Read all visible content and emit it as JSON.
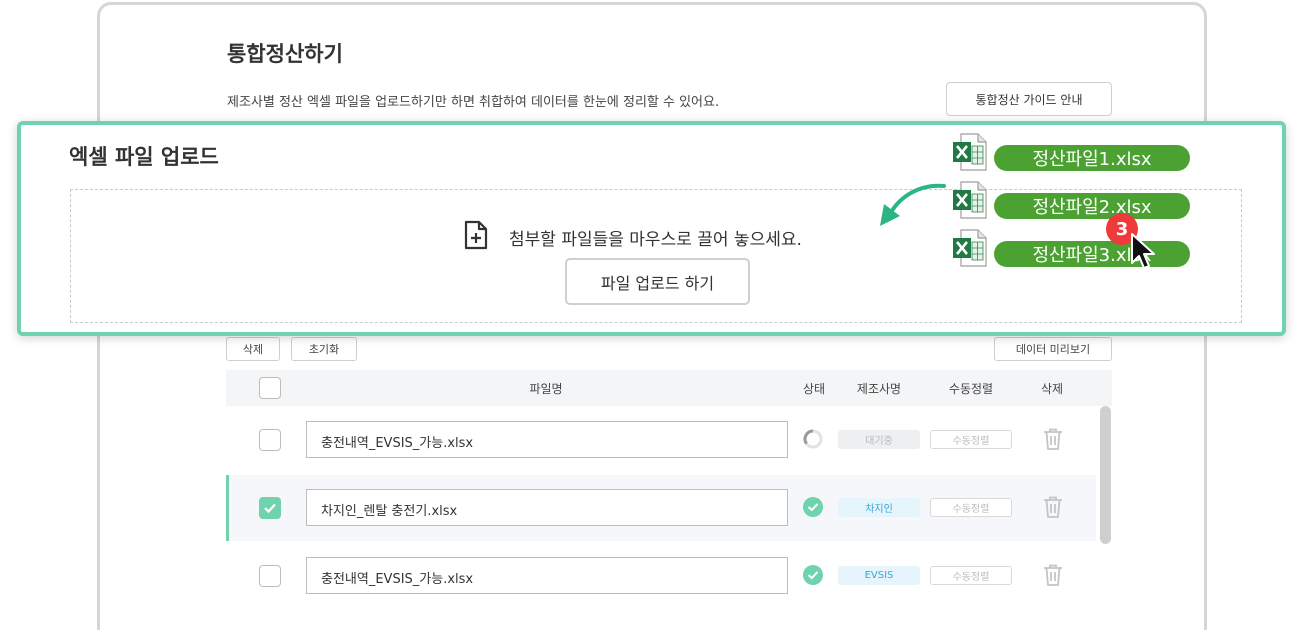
{
  "page": {
    "title": "통합정산하기",
    "description": "제조사별 정산 엑셀 파일을 업로드하기만 하면 취합하여 데이터를 한눈에 정리할 수 있어요.",
    "guide_button": "통합정산 가이드 안내"
  },
  "upload": {
    "title": "엑셀 파일 업로드",
    "drop_hint": "첨부할 파일들을 마우스로 끌어 놓으세요.",
    "upload_button": "파일 업로드 하기",
    "dragged_files": [
      "정산파일1.xlsx",
      "정산파일2.xlsx",
      "정산파일3.xlsx"
    ],
    "step_badge": "3"
  },
  "toolbar": {
    "delete": "삭제",
    "reset": "초기화",
    "preview": "데이터 미리보기"
  },
  "table": {
    "headers": {
      "filename": "파일명",
      "status": "상태",
      "maker": "제조사명",
      "manual_sort": "수동정렬",
      "delete": "삭제"
    },
    "rows": [
      {
        "filename": "충전내역_EVSIS_가능.xlsx",
        "status": "loading",
        "maker": "대기중",
        "sort": "수동정렬",
        "checked": false
      },
      {
        "filename": "차지인_렌탈 충전기.xlsx",
        "status": "done",
        "maker": "차지인",
        "sort": "수동정렬",
        "checked": true
      },
      {
        "filename": "충전내역_EVSIS_가능.xlsx",
        "status": "done",
        "maker": "EVSIS",
        "sort": "수동정렬",
        "checked": false
      }
    ]
  },
  "colors": {
    "accent": "#6fd3ad",
    "excel_green": "#4ba232",
    "badge_red": "#ee3a3a",
    "maker_blue": "#33a6d9"
  }
}
